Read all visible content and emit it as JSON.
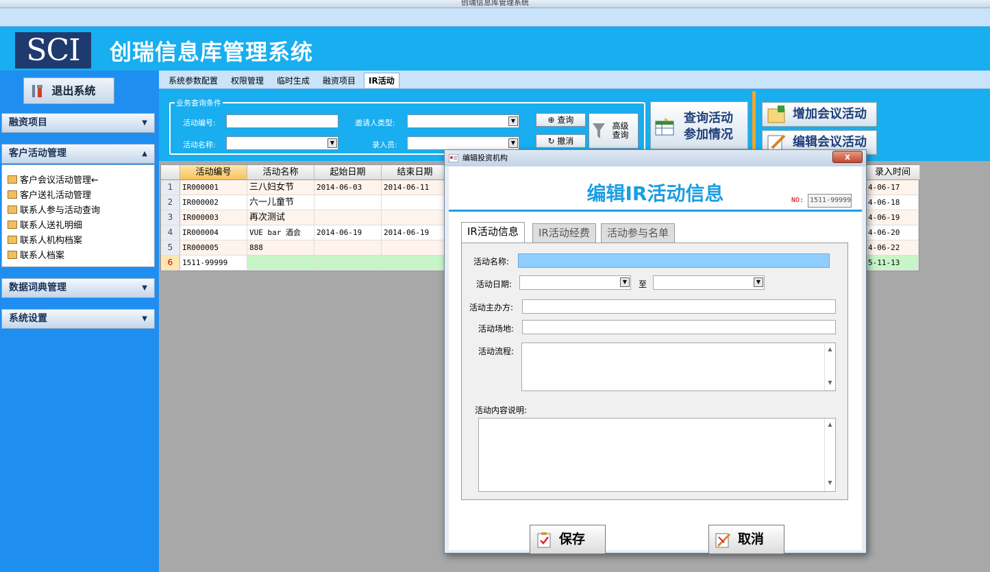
{
  "window": {
    "title": "创瑞信息库管理系统"
  },
  "banner": {
    "logo": "SCI",
    "title": "创瑞信息库管理系统"
  },
  "sidebar": {
    "exit_label": "退出系统",
    "sections": [
      {
        "label": "融资项目",
        "arrow": "▼"
      },
      {
        "label": "客户活动管理",
        "arrow": "▲"
      },
      {
        "label": "数据词典管理",
        "arrow": "▼"
      },
      {
        "label": "系统设置",
        "arrow": "▼"
      }
    ],
    "items": [
      "客户会议活动管理←",
      "客户送礼活动管理",
      "联系人参与活动查询",
      "联系人送礼明细",
      "联系人机构档案",
      "联系人档案"
    ]
  },
  "tabs": [
    "系统参数配置",
    "权限管理",
    "临时生成",
    "融资项目",
    "IR活动"
  ],
  "query": {
    "legend": "业务查询条件",
    "labels": {
      "code": "活动编号:",
      "name": "活动名称:",
      "invitee_type": "邀请人类型:",
      "recorder": "录入员:"
    },
    "search_label": "查询",
    "reset_label": "撤消",
    "advanced_line1": "高级",
    "advanced_line2": "查询",
    "stats_line1": "查询活动",
    "stats_line2": "参加情况",
    "add_label": "增加会议活动",
    "edit_label": "编辑会议活动"
  },
  "grid": {
    "headers": [
      "活动编号",
      "活动名称",
      "起始日期",
      "结束日期",
      "录入时间"
    ],
    "rows": [
      {
        "n": "1",
        "code": "IR000001",
        "name": "三八妇女节",
        "start": "2014-06-03",
        "end": "2014-06-11",
        "rec": "4-06-17"
      },
      {
        "n": "2",
        "code": "IR000002",
        "name": "六一儿童节",
        "start": "",
        "end": "",
        "rec": "4-06-18"
      },
      {
        "n": "3",
        "code": "IR000003",
        "name": "再次测试",
        "start": "",
        "end": "",
        "rec": "4-06-19"
      },
      {
        "n": "4",
        "code": "IR000004",
        "name": "VUE bar 酒会",
        "start": "2014-06-19",
        "end": "2014-06-19",
        "rec": "4-06-20"
      },
      {
        "n": "5",
        "code": "IR000005",
        "name": "888",
        "start": "",
        "end": "",
        "rec": "4-06-22"
      },
      {
        "n": "6",
        "code": "1511-99999",
        "name": "",
        "start": "",
        "end": "",
        "rec": "5-11-13"
      }
    ]
  },
  "dialog": {
    "title": "编辑投资机构",
    "close": "x",
    "heading": "编辑IR活动信息",
    "no_label": "NO:",
    "no_value": "1511-99999",
    "tabs": [
      "IR活动信息",
      "IR活动经费",
      "活动参与名单"
    ],
    "fields": {
      "name": "活动名称:",
      "date": "活动日期:",
      "to": "至",
      "organizer": "活动主办方:",
      "venue": "活动场地:",
      "process": "活动流程:",
      "description": "活动内容说明:"
    },
    "save_label": "保存",
    "cancel_label": "取消"
  },
  "colors": {
    "banner": "#18aeef",
    "sidebar": "#1f8ef1",
    "accent": "#1b9ee0"
  }
}
